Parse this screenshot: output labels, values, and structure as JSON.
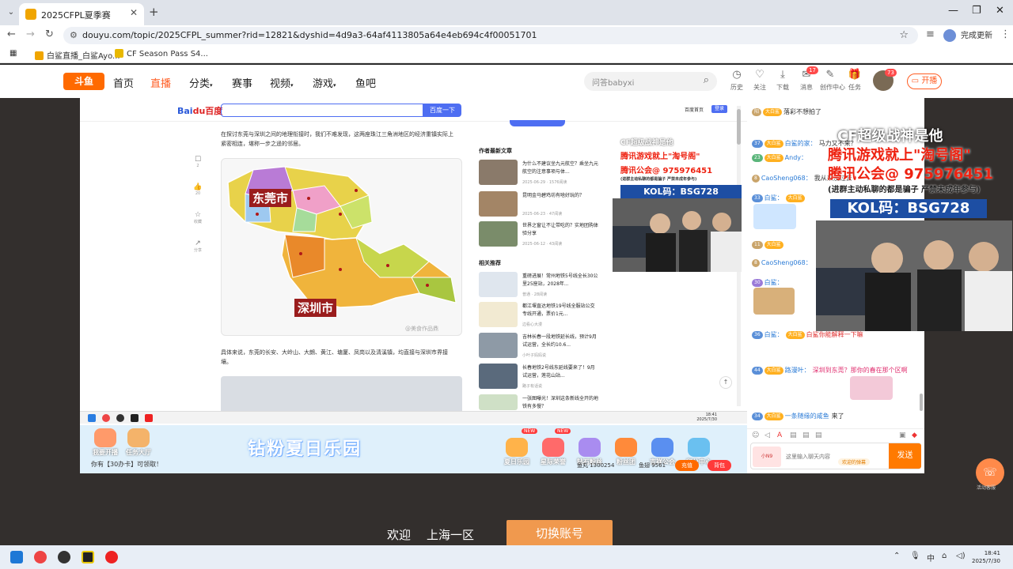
{
  "browser": {
    "tab_title": "2025CFPL夏季赛",
    "url": "douyu.com/topic/2025CFPL_summer?rid=12821&dyshid=4d9a3-64af4113805a64e4eb694c4f00051701",
    "done_label": "完成更新",
    "bookmarks": [
      "白鲨直播_白鲨Ayo...",
      "CF Season Pass S4..."
    ]
  },
  "douyu": {
    "logo": "斗鱼",
    "nav": [
      "首页",
      "直播",
      "分类",
      "赛事",
      "视频",
      "游戏",
      "鱼吧"
    ],
    "search_placeholder": "问答babyxi",
    "header_icons": [
      {
        "icon": "history-icon",
        "label": "历史"
      },
      {
        "icon": "follow-icon",
        "label": "关注"
      },
      {
        "icon": "download-icon",
        "label": "下载"
      },
      {
        "icon": "message-icon",
        "label": "消息",
        "badge": "17"
      },
      {
        "icon": "creator-icon",
        "label": "创作中心"
      },
      {
        "icon": "gift-icon",
        "label": "任务"
      }
    ],
    "user_badge": "73",
    "broadcast_label": "开播"
  },
  "stream": {
    "baidu": {
      "logo_a": "Bai",
      "logo_b": "du",
      "logo_c": "百度",
      "search_button": "百度一下",
      "home_link": "百度首页",
      "login": "登录"
    },
    "side_tools": [
      {
        "icon": "comment-icon",
        "label": "2"
      },
      {
        "icon": "like-icon",
        "label": "20"
      },
      {
        "icon": "collect-icon",
        "label": "收藏"
      },
      {
        "icon": "share-icon",
        "label": "分享"
      }
    ],
    "article_p1": "在探讨东莞与深圳之间的地理衔接时，我们不难发现，这两座珠江三角洲地区的经济重镇实际上紧密相连，堪称一步之遥的邻居。",
    "map_label_top": "东莞市",
    "map_label_bottom": "深圳市",
    "map_watermark": "@美食作品鼎",
    "article_p2": "具体来说，东莞的长安、大岭山、大朗、黄江、塘厦、凤岗以及清溪镇，均直接与深圳市界接壤。",
    "author_section": "作者最新文章",
    "author_articles": [
      {
        "title": "为什么不建议坐九元航空？乘坐九元航空的注意事项与体...",
        "meta": "2025-06-29 · 1576阅读"
      },
      {
        "title": "昆明金马碧鸡坊有啥好玩的？",
        "meta": "2025-06-23 · 47阅读"
      },
      {
        "title": "世界之窗让不让带吃的？实地团购体验分享",
        "meta": "2025-06-12 · 43阅读"
      }
    ],
    "related_section": "相关推荐",
    "related_articles": [
      {
        "title": "重磅进展！常州地铁5号线全长30公里25座站，2028年...",
        "meta": "普通 · 28阅读"
      },
      {
        "title": "都江堰直达地铁19号线全服站公交专线开通，票价1元...",
        "meta": "边看心大漫"
      },
      {
        "title": "吉林长春一段地铁延长线，预计9月试运营，全长约10.6...",
        "meta": "小叶子妈妈说"
      },
      {
        "title": "长春地铁2号线东延线要来了！9月试运营，莲花山站...",
        "meta": "路子有话说"
      },
      {
        "title": "一张图曝光！深圳这条新线全开的地铁有多慢？",
        "meta": ""
      }
    ],
    "ad": {
      "line1": "CF超级战神是他",
      "line2": "腾讯游戏就上\"淘号阁\"",
      "line3": "腾讯公会@ 975976451",
      "line4": "(进群主动私聊的都是骗子 严禁未成年参与)",
      "kol": "KOL码：BSG728"
    },
    "taskbar_time": "18:41",
    "taskbar_date": "2025/7/30",
    "promo": {
      "title": "钻粉夏日乐园",
      "left_buttons": [
        "我要开播",
        "任务大厅"
      ],
      "tip": "你有【30办卡】可领取！",
      "right_buttons": [
        {
          "label": "夏日乐园",
          "badge": "NEW"
        },
        {
          "label": "星际荣誉",
          "badge": "NEW"
        },
        {
          "label": "钻石粉丝",
          "badge": ""
        },
        {
          "label": "粉丝团",
          "badge": ""
        },
        {
          "label": "吉祥公会",
          "badge": ""
        },
        {
          "label": "积分中心",
          "badge": ""
        }
      ],
      "fish_ball": "鱼丸 1300254",
      "fish_wing": "鱼翅 9561",
      "charge": "充值",
      "backpack": "背包"
    }
  },
  "chat": {
    "messages": [
      {
        "level": "",
        "fan": "大白鲨",
        "user": "",
        "text": "落彩不想拍了",
        "lvl_color": "#c9a46a"
      },
      {
        "level": "37",
        "fan": "大白鲨",
        "user": "白鲨的家：",
        "text": "马力又不来？",
        "lvl_color": "#5a8fd8"
      },
      {
        "level": "23",
        "fan": "大白鲨",
        "user": "Andy：",
        "text": "",
        "lvl_color": "#5ab57a"
      },
      {
        "level": "",
        "fan": "",
        "user": "CaoSheng068：",
        "text": "我从来没过去",
        "lvl_color": "#c9a46a"
      },
      {
        "level": "33",
        "fan": "大白鲨",
        "user": "白鲨：",
        "text": "",
        "lvl_color": "#5a8fd8"
      },
      {
        "level": "11",
        "fan": "大白鲨",
        "user": "",
        "text": "",
        "lvl_color": "#c9a46a"
      },
      {
        "level": "",
        "fan": "",
        "user": "CaoSheng068：",
        "text": "",
        "lvl_color": "#c9a46a"
      },
      {
        "level": "30",
        "fan": "",
        "user": "白鲨：",
        "text": "",
        "lvl_color": "#9a7ad8"
      },
      {
        "level": "36",
        "fan": "大白鲨",
        "user": "白鲨：",
        "text": "白鲨你能解释一下嘛",
        "lvl_color": "#5a8fd8"
      },
      {
        "level": "44",
        "fan": "大白鲨",
        "user": "路漫叶：",
        "text": "深圳到东莞？那你的春在那个区啊",
        "lvl_color": "#5a8fd8"
      },
      {
        "level": "34",
        "fan": "大白鲨",
        "user": "一条随缘的咸鱼",
        "text": "来了",
        "lvl_color": "#5a8fd8"
      }
    ],
    "input_placeholder": "这里输入聊天内容",
    "avatar_label": "小N9",
    "pill": "欢迎的弹幕",
    "send_label": "发送"
  },
  "overlay": {
    "line1": "CF超级战神是他",
    "line2": "腾讯游戏就上\"淘号阁\"",
    "line3": "腾讯公会@ 975976451",
    "line4": "(进群主动私聊的都是骗子 严禁未成年参与)",
    "kol": "KOL码：BSG728",
    "service_label": "活动客服"
  },
  "launcher": {
    "welcome": "欢迎",
    "region": "上海一区",
    "switch_account": "切换账号"
  },
  "taskbar": {
    "time": "18:41",
    "date": "2025/7/30",
    "ime": "中"
  }
}
